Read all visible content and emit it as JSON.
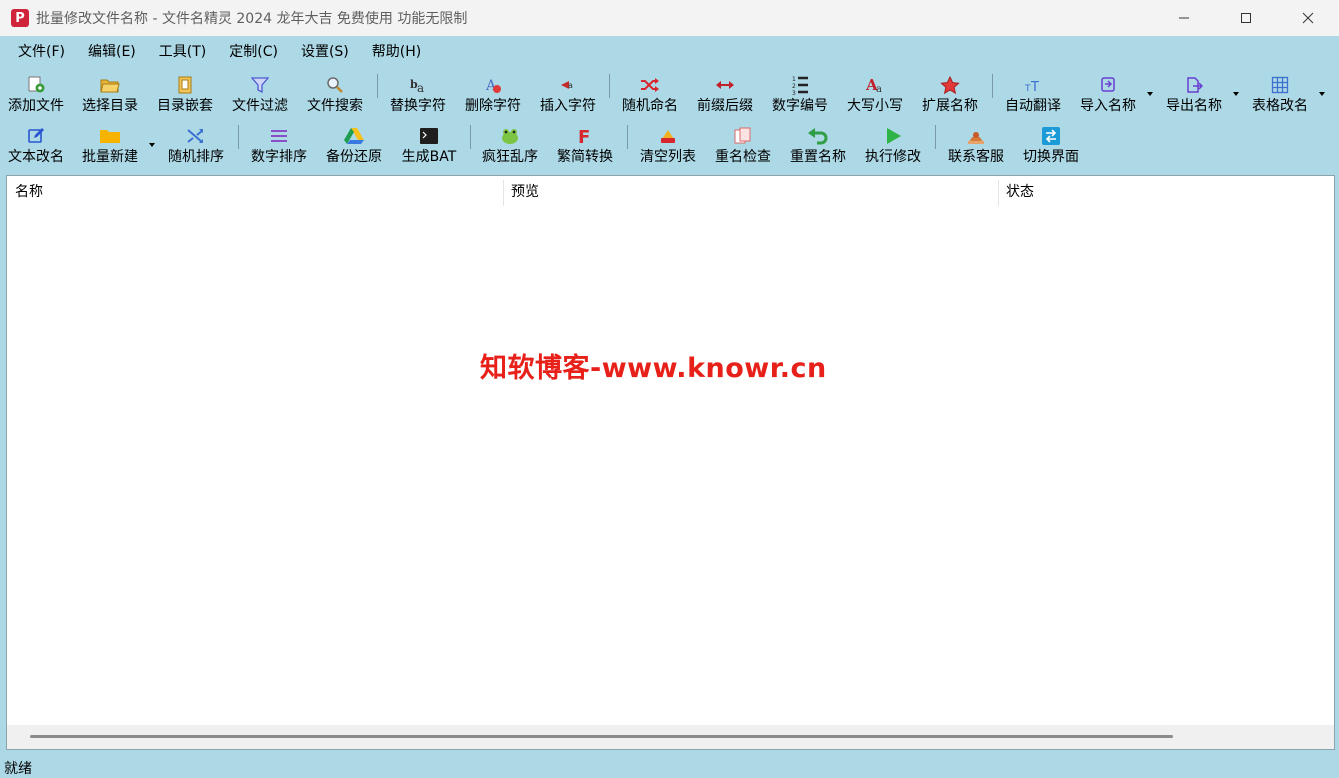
{
  "window": {
    "title": "批量修改文件名称 - 文件名精灵 2024 龙年大吉 免费使用 功能无限制",
    "app_icon_glyph": "P"
  },
  "menu": [
    "文件(F)",
    "编辑(E)",
    "工具(T)",
    "定制(C)",
    "设置(S)",
    "帮助(H)"
  ],
  "toolbar1": [
    {
      "label": "添加文件",
      "icon": "add-file-icon"
    },
    {
      "label": "选择目录",
      "icon": "folder-open-icon"
    },
    {
      "label": "目录嵌套",
      "icon": "nested-folder-icon"
    },
    {
      "label": "文件过滤",
      "icon": "filter-icon"
    },
    {
      "label": "文件搜索",
      "icon": "search-icon"
    },
    {
      "label": "替换字符",
      "icon": "replace-text-icon"
    },
    {
      "label": "删除字符",
      "icon": "delete-text-icon"
    },
    {
      "label": "插入字符",
      "icon": "insert-text-icon"
    },
    {
      "label": "随机命名",
      "icon": "shuffle-icon"
    },
    {
      "label": "前缀后缀",
      "icon": "arrows-horizontal-icon"
    },
    {
      "label": "数字编号",
      "icon": "numbered-list-icon"
    },
    {
      "label": "大写小写",
      "icon": "letter-case-icon"
    },
    {
      "label": "扩展名称",
      "icon": "star-icon"
    },
    {
      "label": "自动翻译",
      "icon": "translate-icon"
    },
    {
      "label": "导入名称",
      "icon": "import-icon"
    },
    {
      "label": "导出名称",
      "icon": "export-icon"
    },
    {
      "label": "表格改名",
      "icon": "table-icon"
    }
  ],
  "toolbar2": [
    {
      "label": "文本改名",
      "icon": "edit-text-icon"
    },
    {
      "label": "批量新建",
      "icon": "new-folder-icon"
    },
    {
      "label": "随机排序",
      "icon": "random-sort-icon"
    },
    {
      "label": "数字排序",
      "icon": "number-sort-icon"
    },
    {
      "label": "备份还原",
      "icon": "drive-icon"
    },
    {
      "label": "生成BAT",
      "icon": "terminal-icon"
    },
    {
      "label": "疯狂乱序",
      "icon": "frog-icon"
    },
    {
      "label": "繁简转换",
      "icon": "convert-f-icon"
    },
    {
      "label": "清空列表",
      "icon": "eraser-icon"
    },
    {
      "label": "重名检查",
      "icon": "duplicate-icon"
    },
    {
      "label": "重置名称",
      "icon": "undo-icon"
    },
    {
      "label": "执行修改",
      "icon": "play-icon"
    },
    {
      "label": "联系客服",
      "icon": "support-icon"
    },
    {
      "label": "切换界面",
      "icon": "switch-icon"
    }
  ],
  "list": {
    "columns": [
      "名称",
      "预览",
      "状态"
    ],
    "watermark": "知软博客-www.knowr.cn"
  },
  "status": "就绪",
  "colors": {
    "background": "#add8e6",
    "watermark": "#e8201a"
  }
}
